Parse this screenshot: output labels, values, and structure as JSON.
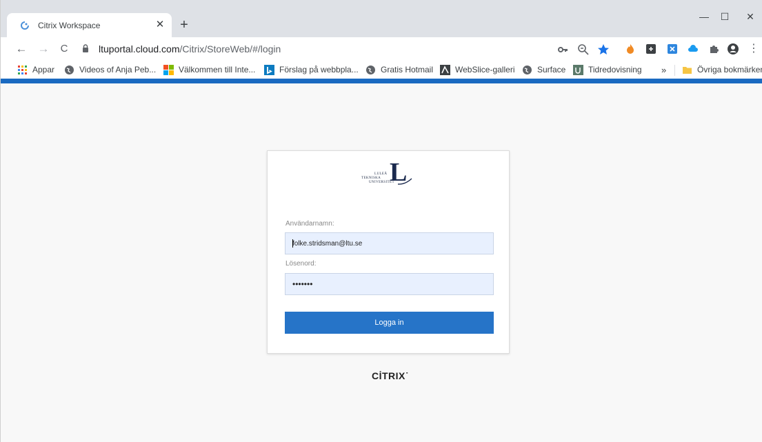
{
  "browser": {
    "tab_title": "Citrix Workspace",
    "tab_close": "✕",
    "new_tab": "+",
    "minimize": "—",
    "maximize": "☐",
    "close": "✕",
    "back": "←",
    "forward": "→",
    "reload": "C",
    "url_host": "ltuportal.cloud.com",
    "url_path": "/Citrix/StoreWeb/#/login",
    "menu": "⋮"
  },
  "bookmarks": {
    "items": [
      {
        "label": "Appar"
      },
      {
        "label": "Videos of Anja Peb..."
      },
      {
        "label": "Välkommen till Inte..."
      },
      {
        "label": "Förslag på webbpla..."
      },
      {
        "label": "Gratis Hotmail"
      },
      {
        "label": "WebSlice-galleri"
      },
      {
        "label": "Surface"
      },
      {
        "label": "Tidredovisning"
      }
    ],
    "overflow": "»",
    "other_folder": "Övriga bokmärken"
  },
  "colors": {
    "accent": "#2674c8",
    "header_bar": "#1a6ac1",
    "input_bg": "#e8f0fe"
  },
  "login": {
    "logo": {
      "line1": "LULEÅ",
      "line2": "TEKNISKA",
      "line3": "UNIVERSITET",
      "letter": "L"
    },
    "username_label": "Användarnamn:",
    "username_value": "folke.stridsman@ltu.se",
    "password_label": "Lösenord:",
    "password_value": "passwd1",
    "submit_label": "Logga in"
  },
  "footer": {
    "brand": "CİTRIX˙"
  }
}
